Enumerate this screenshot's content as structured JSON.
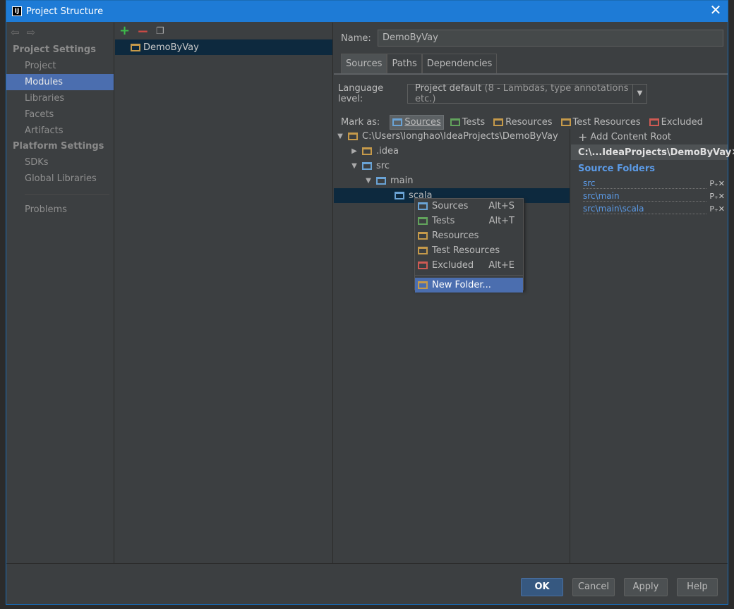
{
  "window": {
    "title": "Project Structure",
    "close_glyph": "✕",
    "app_icon": "IJ"
  },
  "sidebar": {
    "sections": [
      {
        "header": "Project Settings",
        "items": [
          "Project",
          "Modules",
          "Libraries",
          "Facets",
          "Artifacts"
        ]
      },
      {
        "header": "Platform Settings",
        "items": [
          "SDKs",
          "Global Libraries"
        ]
      }
    ],
    "problems": "Problems",
    "active_item": "Modules"
  },
  "modules": {
    "items": [
      "DemoByVay"
    ]
  },
  "detail": {
    "name_label": "Name:",
    "name_value": "DemoByVay",
    "tabs": [
      "Sources",
      "Paths",
      "Dependencies"
    ],
    "active_tab": "Sources",
    "language_label": "Language level:",
    "language_value": "Project default",
    "language_hint": "(8 - Lambdas, type annotations etc.)",
    "mark_as_label": "Mark as:",
    "mark_buttons": [
      "Sources",
      "Tests",
      "Resources",
      "Test Resources",
      "Excluded"
    ],
    "tree": [
      {
        "label": "C:\\Users\\longhao\\IdeaProjects\\DemoByVay",
        "depth": 0,
        "arrow": "▼"
      },
      {
        "label": ".idea",
        "depth": 1,
        "arrow": "▶"
      },
      {
        "label": "src",
        "depth": 1,
        "arrow": "▼"
      },
      {
        "label": "main",
        "depth": 2,
        "arrow": "▼"
      },
      {
        "label": "scala",
        "depth": 3,
        "arrow": ""
      }
    ],
    "add_content_root": "Add Content Root",
    "content_root_path": "C:\\...IdeaProjects\\DemoByVay",
    "source_folders_header": "Source Folders",
    "source_folders": [
      "src",
      "src\\main",
      "src\\main\\scala"
    ]
  },
  "context_menu": {
    "items": [
      {
        "label": "Sources",
        "shortcut": "Alt+S"
      },
      {
        "label": "Tests",
        "shortcut": "Alt+T"
      },
      {
        "label": "Resources",
        "shortcut": ""
      },
      {
        "label": "Test Resources",
        "shortcut": ""
      },
      {
        "label": "Excluded",
        "shortcut": "Alt+E"
      }
    ],
    "new_folder": "New Folder..."
  },
  "footer": {
    "ok": "OK",
    "cancel": "Cancel",
    "apply": "Apply",
    "help": "Help"
  },
  "colors": {
    "accent": "#4b6eaf",
    "title_bar": "#1e7bd6",
    "source_blue": "#5b9ae6"
  }
}
